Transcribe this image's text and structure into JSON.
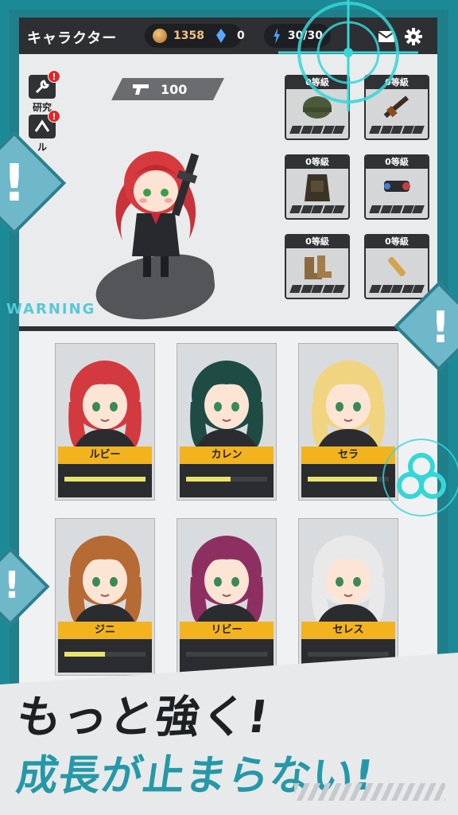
{
  "header": {
    "title": "キャラクター",
    "coins": "1358",
    "gems": "0",
    "energy": "30/30"
  },
  "side_buttons": [
    {
      "label": "研究",
      "icon": "wrench-icon",
      "badge": "!"
    },
    {
      "label": "ル",
      "icon": "rank-icon",
      "badge": "!"
    }
  ],
  "ammo": {
    "icon": "pistol-icon",
    "count": "100"
  },
  "equipment": [
    {
      "grade": "0等級",
      "item": "helmet-icon"
    },
    {
      "grade": "0等級",
      "item": "rifle-icon"
    },
    {
      "grade": "0等級",
      "item": "vest-icon"
    },
    {
      "grade": "0等級",
      "item": "scope-icon"
    },
    {
      "grade": "0等級",
      "item": "boots-icon"
    },
    {
      "grade": "0等級",
      "item": "bullet-icon"
    }
  ],
  "characters": [
    {
      "name": "ルビー",
      "hair": "#d23a3f",
      "xp": 1.0
    },
    {
      "name": "カレン",
      "hair": "#1f4b45",
      "xp": 0.55
    },
    {
      "name": "セラ",
      "hair": "#f1d47f",
      "xp": 0.85
    },
    {
      "name": "ジニ",
      "hair": "#b66a34",
      "xp": 0.5
    },
    {
      "name": "リビー",
      "hair": "#8e2f62",
      "xp": 0.0
    },
    {
      "name": "セレス",
      "hair": "#e9e9ea",
      "xp": 0.0
    }
  ],
  "warning_label": "WARNING",
  "tagline": {
    "line1": "もっと強く!",
    "line2": "成長が止まらない!"
  },
  "colors": {
    "accent": "#1f8c99",
    "card_label": "#f3b31f",
    "warning": "#58c8d8"
  }
}
